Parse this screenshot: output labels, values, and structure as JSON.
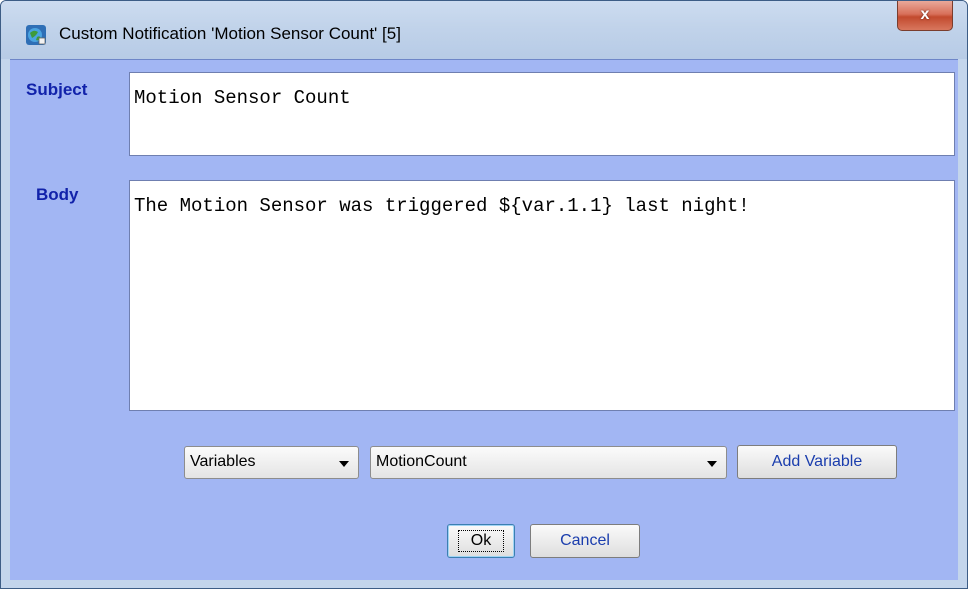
{
  "window": {
    "title": "Custom Notification 'Motion Sensor Count' [5]",
    "close_glyph": "x",
    "icon": "globe-app-icon"
  },
  "form": {
    "subject_label": "Subject",
    "subject_value": "Motion Sensor Count",
    "body_label": "Body",
    "body_value": "The Motion Sensor was triggered ${var.1.1} last night!"
  },
  "variables": {
    "category_selected": "Variables",
    "variable_selected": "MotionCount",
    "add_button_label": "Add Variable"
  },
  "actions": {
    "ok_label": "Ok",
    "cancel_label": "Cancel"
  },
  "colors": {
    "client_background": "#a2b6f3",
    "label_text": "#1122aa",
    "close_button": "#c24a2e"
  }
}
